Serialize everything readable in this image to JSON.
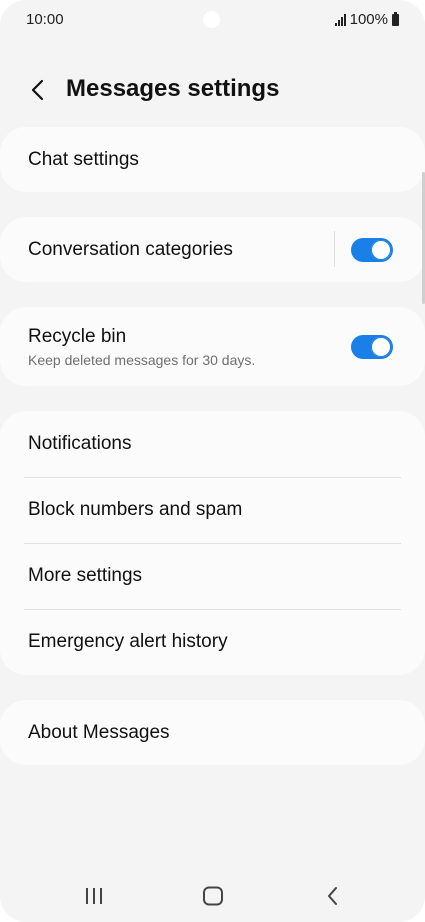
{
  "status_bar": {
    "time": "10:00",
    "battery": "100%"
  },
  "header": {
    "title": "Messages settings"
  },
  "groups": {
    "chat": {
      "label": "Chat settings"
    },
    "conversation": {
      "label": "Conversation categories",
      "enabled": true
    },
    "recycle": {
      "label": "Recycle bin",
      "sub": "Keep deleted messages for 30 days.",
      "enabled": true
    },
    "list": {
      "notifications": "Notifications",
      "block": "Block numbers and spam",
      "more": "More settings",
      "emergency": "Emergency alert history"
    },
    "about": {
      "label": "About Messages"
    }
  },
  "nav": {
    "recents": "recents-icon",
    "home": "home-icon",
    "back": "back-icon"
  },
  "colors": {
    "accent": "#1a7fe6",
    "background": "#f4f4f4",
    "card": "#fbfbfb"
  }
}
